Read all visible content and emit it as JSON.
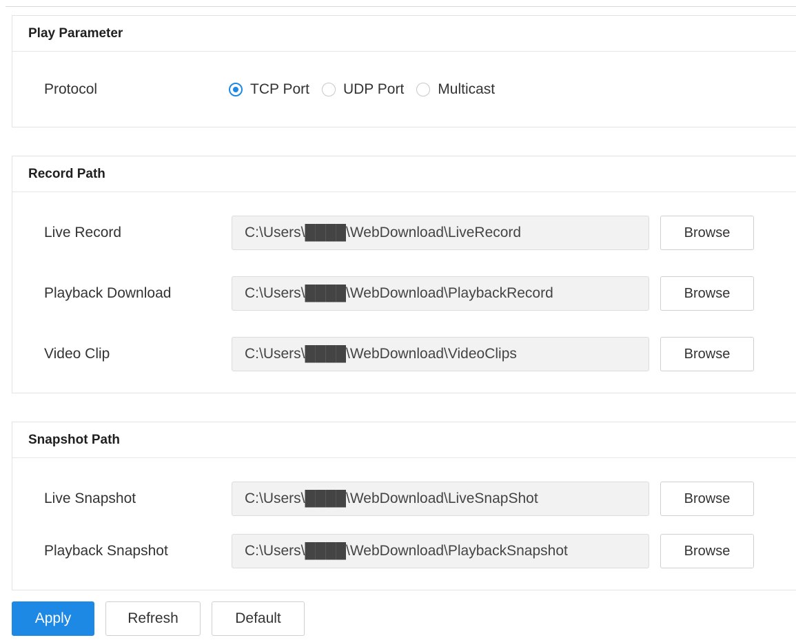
{
  "play_parameter": {
    "title": "Play Parameter",
    "protocol_label": "Protocol",
    "options": [
      "TCP Port",
      "UDP Port",
      "Multicast"
    ],
    "selected": "TCP Port"
  },
  "record_path": {
    "title": "Record Path",
    "rows": [
      {
        "label": "Live Record",
        "value": "C:\\Users\\████\\WebDownload\\LiveRecord",
        "button": "Browse"
      },
      {
        "label": "Playback Download",
        "value": "C:\\Users\\████\\WebDownload\\PlaybackRecord",
        "button": "Browse"
      },
      {
        "label": "Video Clip",
        "value": "C:\\Users\\████\\WebDownload\\VideoClips",
        "button": "Browse"
      }
    ]
  },
  "snapshot_path": {
    "title": "Snapshot Path",
    "rows": [
      {
        "label": "Live Snapshot",
        "value": "C:\\Users\\████\\WebDownload\\LiveSnapShot",
        "button": "Browse"
      },
      {
        "label": "Playback Snapshot",
        "value": "C:\\Users\\████\\WebDownload\\PlaybackSnapshot",
        "button": "Browse"
      }
    ]
  },
  "actions": {
    "apply": "Apply",
    "refresh": "Refresh",
    "default": "Default"
  },
  "colors": {
    "accent": "#1e88e5",
    "field_bg": "#f2f2f2",
    "border": "#e3e3e3"
  }
}
